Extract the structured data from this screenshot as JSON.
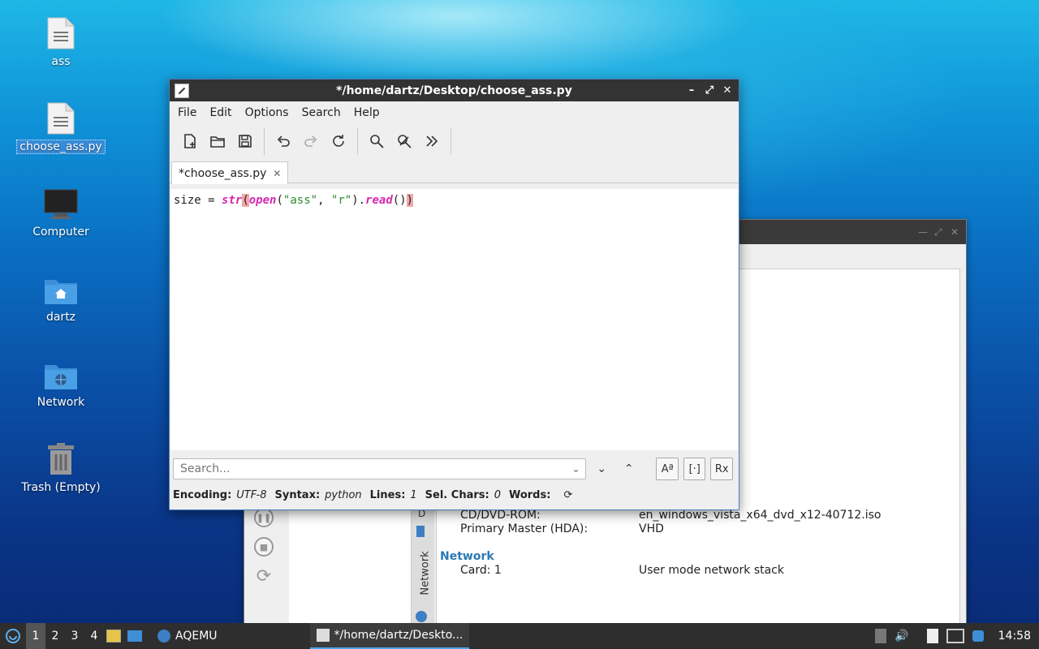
{
  "desktop": {
    "icons": [
      {
        "label": "ass"
      },
      {
        "label": "choose_ass.py"
      },
      {
        "label": "Computer"
      },
      {
        "label": "dartz"
      },
      {
        "label": "Network"
      },
      {
        "label": "Trash (Empty)"
      }
    ]
  },
  "editor": {
    "title": "*/home/dartz/Desktop/choose_ass.py",
    "menu": [
      "File",
      "Edit",
      "Options",
      "Search",
      "Help"
    ],
    "tab_label": "*choose_ass.py",
    "code": {
      "t1": "size = ",
      "t2": "str",
      "t3": "(",
      "t4": "open",
      "t5": "(",
      "t6": "\"ass\"",
      "t7": ", ",
      "t8": "\"r\"",
      "t9": ").",
      "t10": "read",
      "t11": "()",
      "t12": ")"
    },
    "search_placeholder": "Search...",
    "status": {
      "encoding_label": "Encoding:",
      "encoding_value": "UTF-8",
      "syntax_label": "Syntax:",
      "syntax_value": "python",
      "lines_label": "Lines:",
      "lines_value": "1",
      "sel_label": "Sel. Chars:",
      "sel_value": "0",
      "words_label": "Words:"
    }
  },
  "aqemu": {
    "cdrom_label": "CD/DVD-ROM:",
    "cdrom_value": "en_windows_vista_x64_dvd_x12-40712.iso",
    "hda_label": "Primary Master (HDA):",
    "hda_value": "VHD",
    "network_section": "Network",
    "card_label": "Card: 1",
    "card_value": "User mode network stack",
    "vtab_label": "Network",
    "vtab_label2": "D"
  },
  "taskbar": {
    "workspaces": [
      "1",
      "2",
      "3",
      "4"
    ],
    "tasks": [
      {
        "label": "AQEMU"
      },
      {
        "label": "*/home/dartz/Deskto..."
      }
    ],
    "clock": "14:58"
  }
}
